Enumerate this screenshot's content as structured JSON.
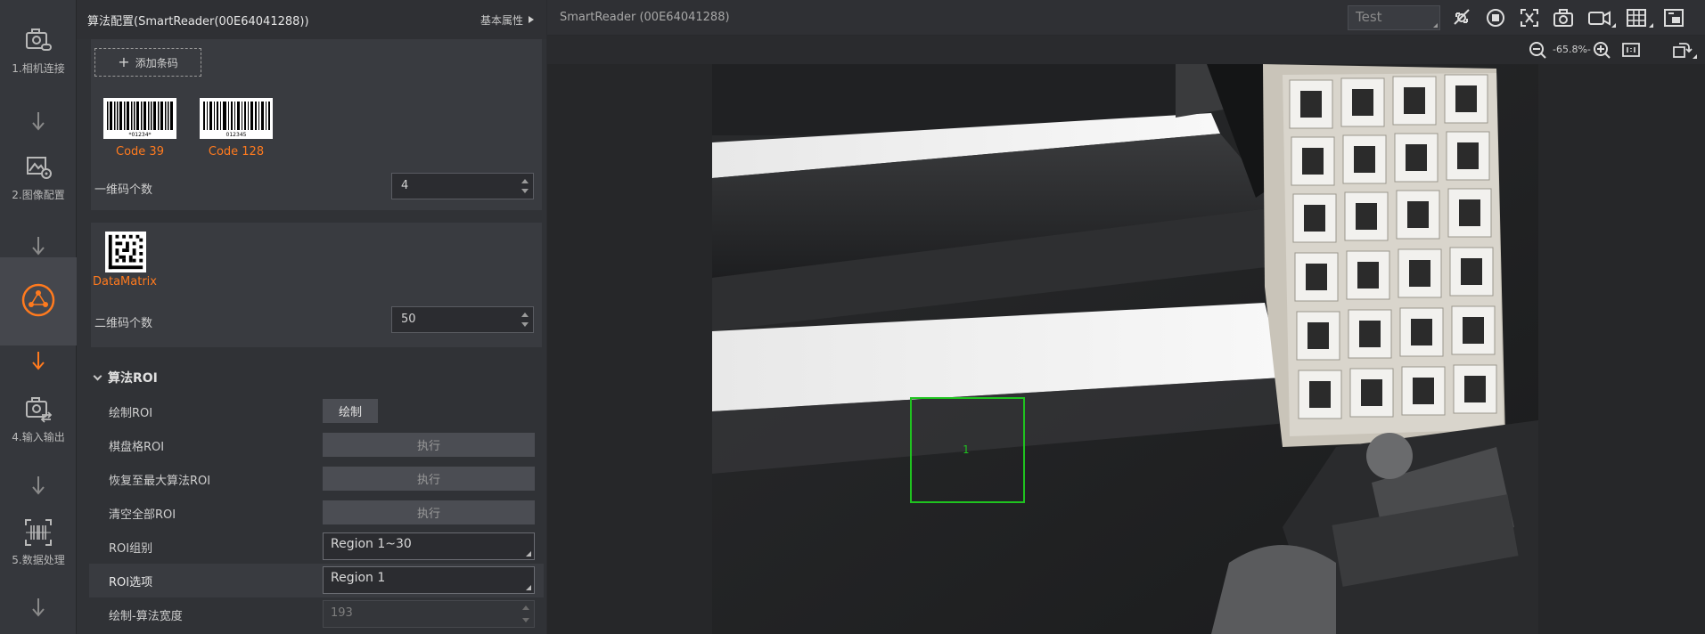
{
  "steps": [
    {
      "label": "1.相机连接",
      "icon": "camera-link-icon"
    },
    {
      "label": "2.图像配置",
      "icon": "image-settings-icon"
    },
    {
      "label": "",
      "icon": "algorithm-icon",
      "active": true
    },
    {
      "label": "4.输入输出",
      "icon": "io-icon"
    },
    {
      "label": "5.数据处理",
      "icon": "barcode-scan-icon"
    }
  ],
  "panel": {
    "title": "算法配置(SmartReader(00E64041288))",
    "basic_props": "基本属性",
    "add_code": "添加条码",
    "codes_1d": [
      {
        "name": "Code 39",
        "digits": "*01234*"
      },
      {
        "name": "Code 128",
        "digits": "012345"
      }
    ],
    "count_1d_label": "一维码个数",
    "count_1d_value": "4",
    "codes_2d": [
      {
        "name": "DataMatrix"
      }
    ],
    "count_2d_label": "二维码个数",
    "count_2d_value": "50",
    "roi_section": "算法ROI",
    "draw_roi_label": "绘制ROI",
    "draw_btn": "绘制",
    "checker_roi_label": "棋盘格ROI",
    "restore_roi_label": "恢复至最大算法ROI",
    "clear_roi_label": "清空全部ROI",
    "exec_btn": "执行",
    "roi_group_label": "ROI组别",
    "roi_group_value": "Region 1~30",
    "roi_option_label": "ROI选项",
    "roi_option_value": "Region 1",
    "draw_width_label": "绘制-算法宽度",
    "draw_width_value": "193"
  },
  "viewer": {
    "title": "SmartReader (00E64041288)",
    "test_placeholder": "Test",
    "toolbar_icons": [
      "trigger-off-icon",
      "stop-icon",
      "fullscreen-x-icon",
      "snapshot-icon",
      "record-icon",
      "grid-icon",
      "window-icon"
    ],
    "zoom_level": "-65.8%-",
    "zoom_icons": [
      "zoom-out-icon",
      "zoom-in-icon",
      "actual-size-icon",
      "rotate-icon"
    ],
    "roi_number": "1"
  },
  "colors": {
    "accent": "#ff7a1e",
    "roi": "#1fc31f",
    "panel_bg": "#303236"
  }
}
